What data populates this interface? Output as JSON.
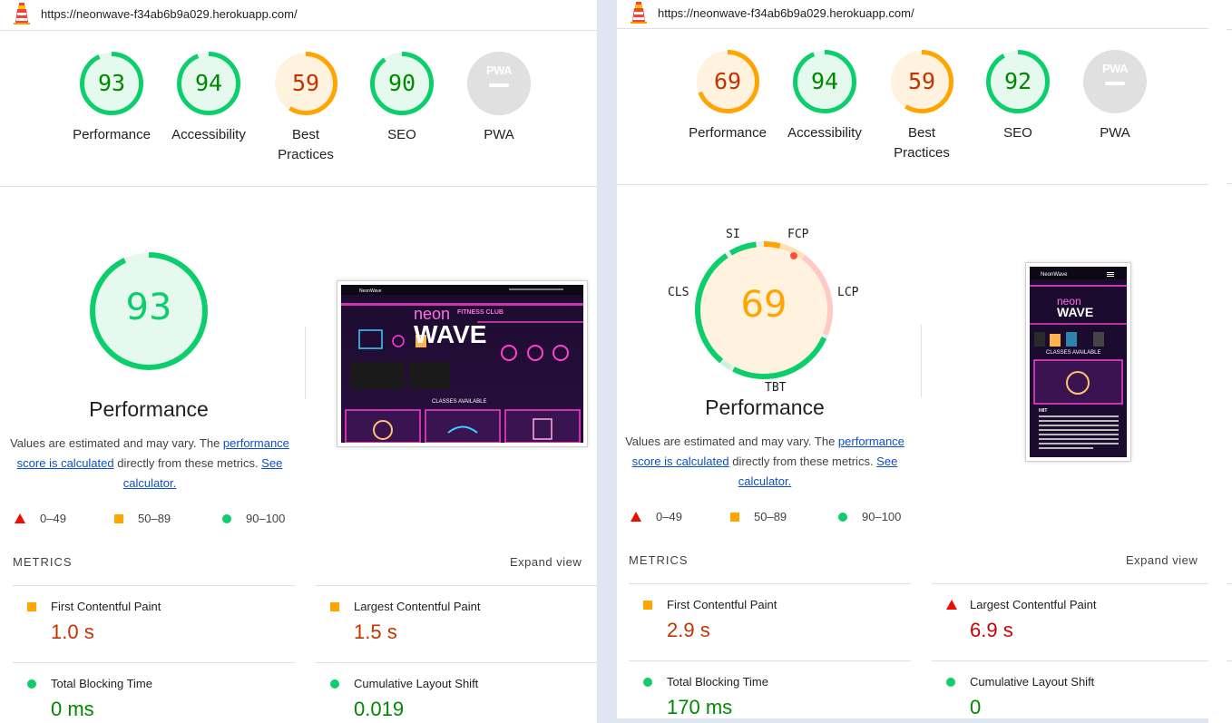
{
  "colors": {
    "pass": "#0cce6b",
    "average": "#ffa400",
    "fail": "#ff4e42",
    "pass_text": "#008800",
    "average_text": "#c33300",
    "fail_text": "#cc0000"
  },
  "left": {
    "url": "https://neonwave-f34ab6b9a029.herokuapp.com/",
    "gauges": [
      {
        "score": "93",
        "label": "Performance",
        "rating": "pass"
      },
      {
        "score": "94",
        "label": "Accessibility",
        "rating": "pass"
      },
      {
        "score": "59",
        "label": "Best Practices",
        "rating": "average"
      },
      {
        "score": "90",
        "label": "SEO",
        "rating": "pass"
      },
      {
        "score": "PWA",
        "label": "PWA",
        "rating": "na"
      }
    ],
    "performance": {
      "score": "93",
      "title": "Performance",
      "desc_pre": "Values are estimated and may vary. The ",
      "desc_link": "performance score is calculated",
      "desc_mid": " directly from these metrics. ",
      "desc_link2": "See calculator."
    },
    "legend": {
      "fail": "0–49",
      "average": "50–89",
      "pass": "90–100"
    },
    "metrics_title": "METRICS",
    "expand": "Expand view",
    "metrics": [
      {
        "name": "First Contentful Paint",
        "value": "1.0 s",
        "rating": "average"
      },
      {
        "name": "Largest Contentful Paint",
        "value": "1.5 s",
        "rating": "average"
      },
      {
        "name": "Total Blocking Time",
        "value": "0 ms",
        "rating": "pass"
      },
      {
        "name": "Cumulative Layout Shift",
        "value": "0.019",
        "rating": "pass"
      }
    ],
    "screenshot": {
      "brand": "NeonWave",
      "hero_neon": "neon",
      "hero_wave": "WAVE",
      "hero_sub": "FITNESS CLUB",
      "classes": "CLASSES AVAILABLE"
    }
  },
  "right": {
    "url": "https://neonwave-f34ab6b9a029.herokuapp.com/",
    "gauges": [
      {
        "score": "69",
        "label": "Performance",
        "rating": "average"
      },
      {
        "score": "94",
        "label": "Accessibility",
        "rating": "pass"
      },
      {
        "score": "59",
        "label": "Best Practices",
        "rating": "average"
      },
      {
        "score": "92",
        "label": "SEO",
        "rating": "pass"
      },
      {
        "score": "PWA",
        "label": "PWA",
        "rating": "na"
      }
    ],
    "performance": {
      "score": "69",
      "title": "Performance",
      "desc_pre": "Values are estimated and may vary. The ",
      "desc_link": "performance score is calculated",
      "desc_mid": " directly from these metrics. ",
      "desc_link2": "See calculator."
    },
    "segments": {
      "si": "SI",
      "fcp": "FCP",
      "lcp": "LCP",
      "tbt": "TBT",
      "cls": "CLS"
    },
    "legend": {
      "fail": "0–49",
      "average": "50–89",
      "pass": "90–100"
    },
    "metrics_title": "METRICS",
    "expand": "Expand view",
    "metrics": [
      {
        "name": "First Contentful Paint",
        "value": "2.9 s",
        "rating": "average"
      },
      {
        "name": "Largest Contentful Paint",
        "value": "6.9 s",
        "rating": "fail"
      },
      {
        "name": "Total Blocking Time",
        "value": "170 ms",
        "rating": "pass"
      },
      {
        "name": "Cumulative Layout Shift",
        "value": "0",
        "rating": "pass"
      }
    ],
    "screenshot": {
      "brand": "NeonWave",
      "hero_neon": "neon",
      "hero_wave": "WAVE",
      "classes": "CLASSES AVAILABLE",
      "card_title": "HIIT"
    }
  }
}
